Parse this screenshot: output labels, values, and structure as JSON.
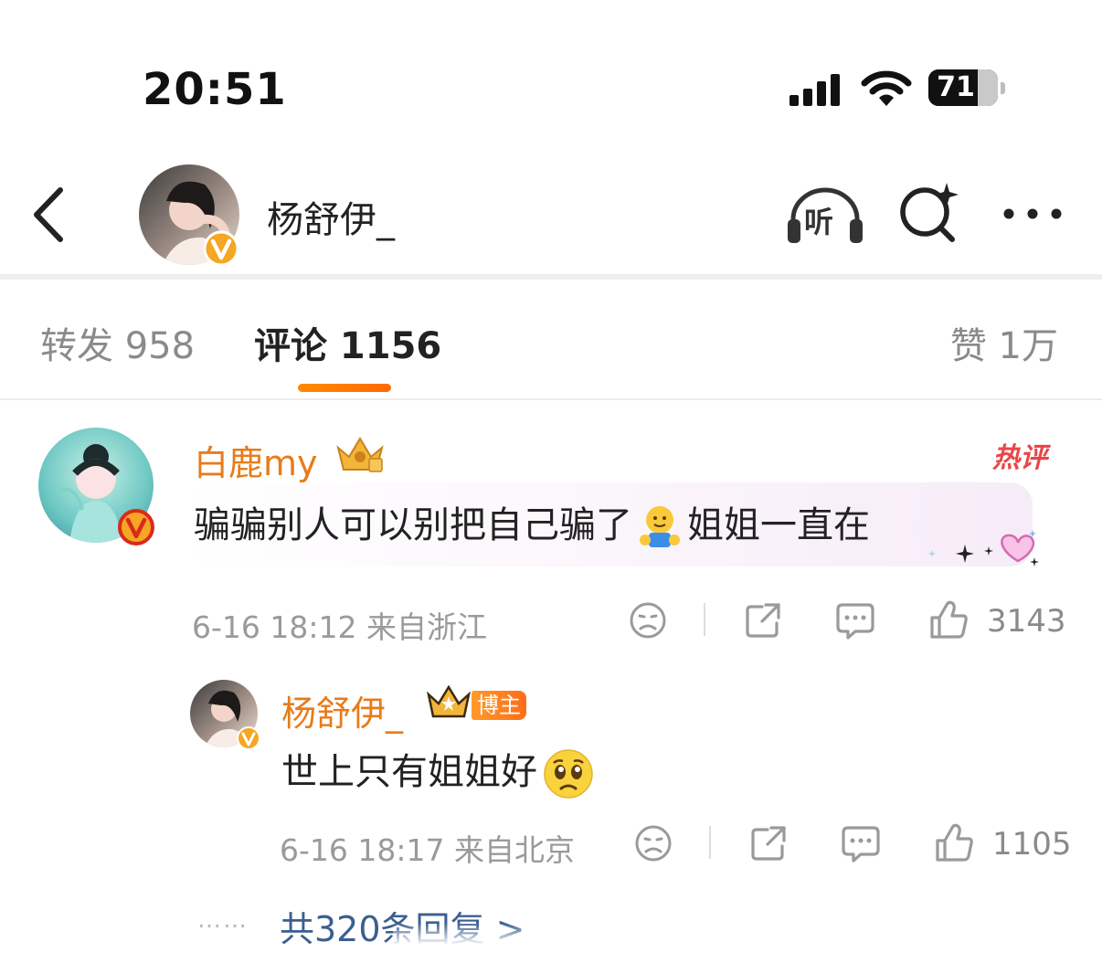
{
  "status_bar": {
    "time": "20:51",
    "battery_level": "71"
  },
  "header": {
    "name": "杨舒伊_",
    "verified_icon": "verified-v-icon",
    "listen_icon_text": "听",
    "colors": {
      "verified": "#f5a623",
      "accent": "#ff8200"
    }
  },
  "tabs": {
    "repost": "转发 958",
    "comment": "评论 1156",
    "like": "赞 1万"
  },
  "comment": {
    "author": "白鹿my",
    "hot_tag": "热评",
    "text_before": "骗骗别人可以别把自己骗了",
    "text_after": "姐姐一直在",
    "meta": "6-16 18:12 来自浙江",
    "like_count": "3143"
  },
  "reply": {
    "author": "杨舒伊_",
    "author_badge": "博主",
    "text": "世上只有姐姐好",
    "meta": "6-16 18:17 来自北京",
    "like_count": "1105"
  },
  "replies_link": {
    "dots": "……",
    "label": "共320条回复 >"
  }
}
